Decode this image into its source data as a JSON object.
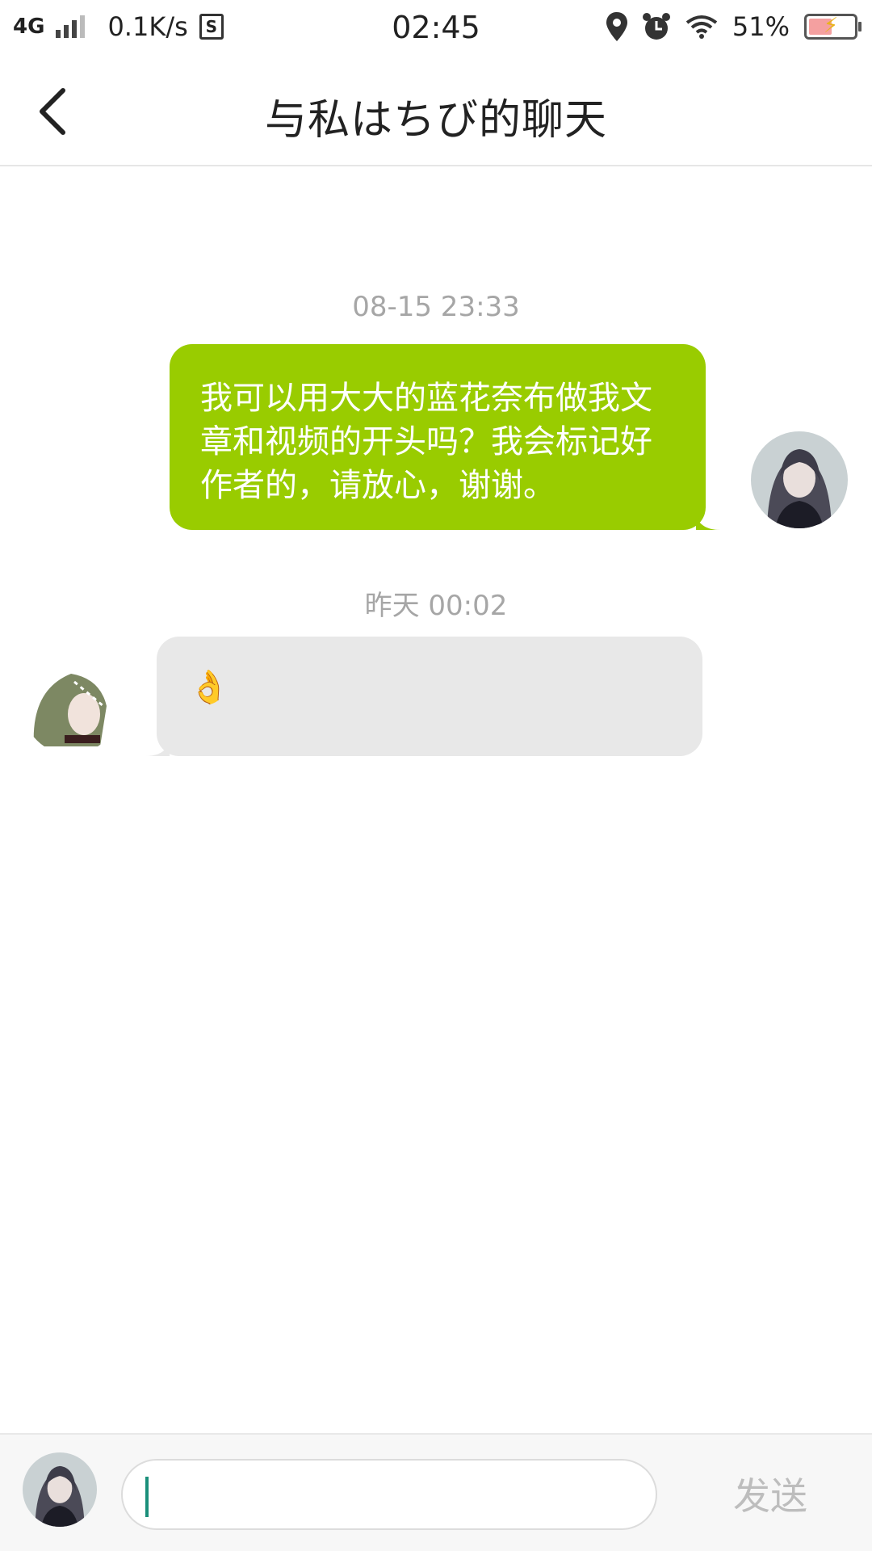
{
  "status_bar": {
    "network": "4G",
    "speed": "0.1K/s",
    "s_icon_letter": "S",
    "time": "02:45",
    "battery": "51%",
    "battery_level": 0.51,
    "icons": [
      "signal-icon",
      "s-app-icon",
      "location-icon",
      "alarm-icon",
      "wifi-icon",
      "battery-icon"
    ]
  },
  "header": {
    "title": "与私はちび的聊天",
    "back_icon": "chevron-left-icon"
  },
  "messages": [
    {
      "timestamp": "08-15 23:33",
      "direction": "sent",
      "text": "我可以用大大的蓝花奈布做我文章和视频的开头吗？我会标记好作者的，请放心，谢谢。"
    },
    {
      "timestamp": "昨天 00:02",
      "direction": "received",
      "text": "👌"
    }
  ],
  "input_bar": {
    "placeholder": "",
    "value": "",
    "send_label": "发送"
  },
  "colors": {
    "sent_bubble": "#99cc00",
    "received_bubble": "#e8e8e8",
    "timestamp": "#a6a6a6",
    "send_disabled": "#bdbdbd"
  }
}
